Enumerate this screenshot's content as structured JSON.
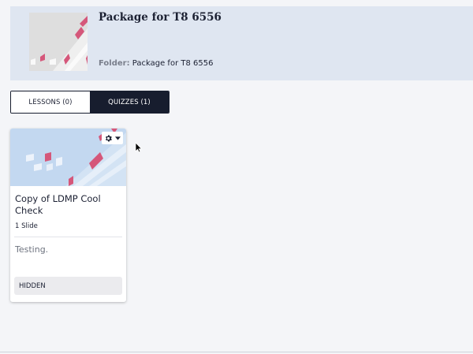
{
  "package": {
    "title": "Package for T8 6556",
    "folder_label": "Folder:",
    "folder_value": "Package for T8 6556"
  },
  "tabs": [
    {
      "label": "LESSONS (0)",
      "active": false
    },
    {
      "label": "QUIZZES (1)",
      "active": true
    }
  ],
  "quiz_card": {
    "title": "Copy of LDMP Cool Check",
    "slides": "1 Slide",
    "description": "Testing.",
    "status_label": "HIDDEN",
    "menu_icon": "gear-icon"
  },
  "colors": {
    "header_bg": "#dfe6f1",
    "active_tab_bg": "#171d2e",
    "banner_bg": "#c3d8f0",
    "accent_pink": "#d5577a"
  }
}
